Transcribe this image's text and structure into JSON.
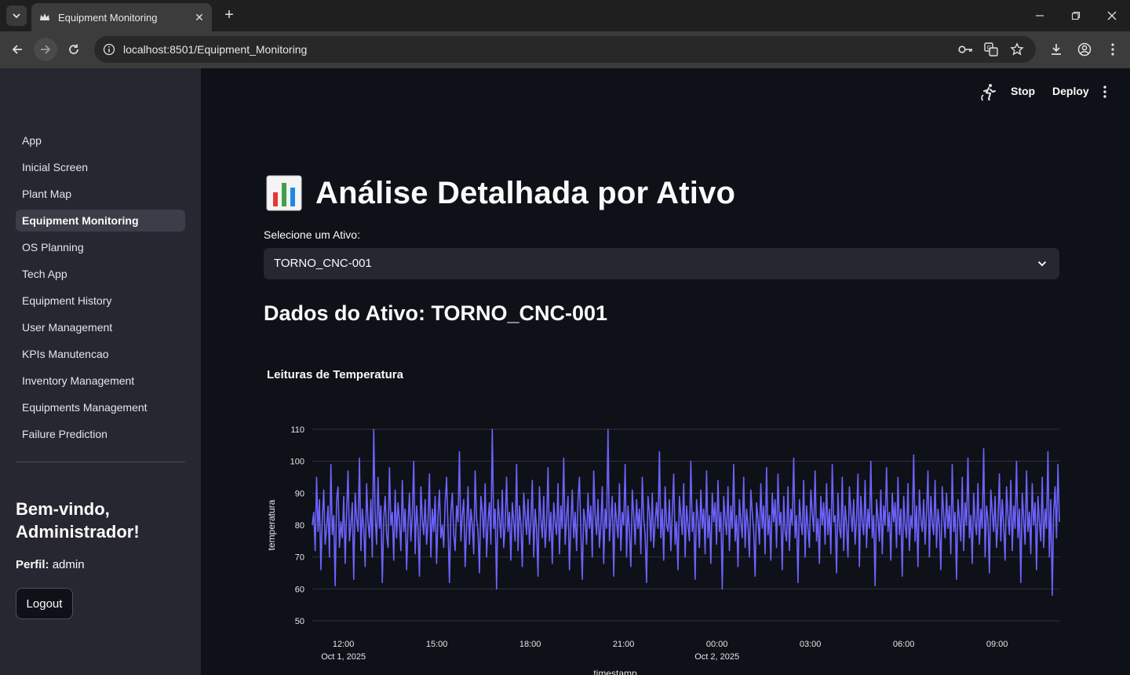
{
  "browser": {
    "tab_title": "Equipment Monitoring",
    "url": "localhost:8501/Equipment_Monitoring"
  },
  "sidebar": {
    "items": [
      {
        "label": "App",
        "active": false
      },
      {
        "label": "Inicial Screen",
        "active": false
      },
      {
        "label": "Plant Map",
        "active": false
      },
      {
        "label": "Equipment Monitoring",
        "active": true
      },
      {
        "label": "OS Planning",
        "active": false
      },
      {
        "label": "Tech App",
        "active": false
      },
      {
        "label": "Equipment History",
        "active": false
      },
      {
        "label": "User Management",
        "active": false
      },
      {
        "label": "KPIs Manutencao",
        "active": false
      },
      {
        "label": "Inventory Management",
        "active": false
      },
      {
        "label": "Equipments Management",
        "active": false
      },
      {
        "label": "Failure Prediction",
        "active": false
      }
    ],
    "welcome": "Bem-vindo, Administrador!",
    "profile_label": "Perfil:",
    "profile_value": "admin",
    "logout_label": "Logout"
  },
  "header": {
    "stop_label": "Stop",
    "deploy_label": "Deploy"
  },
  "main": {
    "title": "Análise Detalhada por Ativo",
    "title_icon": "bar-chart-emoji",
    "select_label": "Selecione um Ativo:",
    "select_value": "TORNO_CNC-001",
    "section_heading": "Dados do Ativo: TORNO_CNC-001",
    "chart_title": "Leituras de Temperatura"
  },
  "colors": {
    "accent": "#6c63ff",
    "background": "#0e1117",
    "sidebar": "#262730"
  },
  "chart_data": {
    "type": "line",
    "title": "Leituras de Temperatura",
    "xlabel": "timestamp",
    "ylabel": "temperatura",
    "ylim": [
      50,
      110
    ],
    "y_ticks": [
      50,
      60,
      70,
      80,
      90,
      100,
      110
    ],
    "x_ticks": [
      {
        "t": 0,
        "label": "12:00",
        "sub": "Oct 1, 2025"
      },
      {
        "t": 3,
        "label": "15:00",
        "sub": ""
      },
      {
        "t": 6,
        "label": "18:00",
        "sub": ""
      },
      {
        "t": 9,
        "label": "21:00",
        "sub": ""
      },
      {
        "t": 12,
        "label": "00:00",
        "sub": "Oct 2, 2025"
      },
      {
        "t": 15,
        "label": "03:00",
        "sub": ""
      },
      {
        "t": 18,
        "label": "06:00",
        "sub": ""
      },
      {
        "t": 21,
        "label": "09:00",
        "sub": ""
      }
    ],
    "x_range_hours": [
      -1,
      23
    ],
    "grid": true,
    "series": [
      {
        "values": [
          80,
          84,
          72,
          95,
          78,
          88,
          66,
          82,
          91,
          74,
          79,
          86,
          70,
          99,
          77,
          83,
          61,
          88,
          92,
          73,
          81,
          76,
          89,
          68,
          84,
          97,
          75,
          80,
          87,
          63,
          90,
          82,
          78,
          101,
          72,
          85,
          79,
          67,
          93,
          81,
          76,
          88,
          70,
          110,
          83,
          74,
          95,
          79,
          86,
          62,
          82,
          89,
          77,
          73,
          98,
          80,
          84,
          69,
          91,
          76,
          87,
          81,
          72,
          94,
          78,
          85,
          66,
          80,
          90,
          75,
          83,
          100,
          71,
          86,
          79,
          64,
          92,
          82,
          77,
          88,
          74,
          81,
          96,
          70,
          85,
          78,
          89,
          68,
          83,
          91,
          76,
          80,
          73,
          87,
          95,
          79,
          62,
          84,
          90,
          77,
          72,
          86,
          81,
          103,
          75,
          83,
          88,
          67,
          79,
          92,
          74,
          85,
          80,
          71,
          97,
          82,
          78,
          65,
          89,
          84,
          76,
          93,
          70,
          81,
          87,
          74,
          110,
          79,
          85,
          60,
          88,
          82,
          76,
          91,
          73,
          80,
          95,
          78,
          84,
          69,
          87,
          81,
          75,
          99,
          72,
          86,
          80,
          67,
          90,
          83,
          77,
          88,
          74,
          81,
          94,
          70,
          85,
          79,
          64,
          92,
          82,
          76,
          89,
          73,
          80,
          98,
          75,
          84,
          68,
          87,
          81,
          77,
          93,
          71,
          86,
          79,
          101,
          74,
          82,
          89,
          66,
          80,
          91,
          76,
          84,
          72,
          88,
          95,
          78,
          63,
          85,
          81,
          74,
          90,
          79,
          86,
          70,
          97,
          83,
          77,
          88,
          73,
          80,
          92,
          68,
          85,
          79,
          110,
          75,
          82,
          89,
          64,
          87,
          81,
          76,
          93,
          72,
          84,
          80,
          99,
          70,
          86,
          78,
          67,
          91,
          83,
          74,
          88,
          79,
          85,
          71,
          95,
          82,
          77,
          62,
          89,
          84,
          75,
          90,
          73,
          81,
          87,
          79,
          103,
          76,
          85,
          69,
          92,
          80,
          78,
          88,
          72,
          84,
          96,
          74,
          81,
          66,
          89,
          83,
          77,
          93,
          70,
          86,
          80,
          75,
          100,
          78,
          84,
          63,
          88,
          82,
          73,
          91,
          79,
          85,
          71,
          97,
          76,
          83,
          68,
          90,
          81,
          87,
          74,
          94,
          78,
          84,
          60,
          89,
          82,
          77,
          92,
          72,
          86,
          79,
          99,
          75,
          83,
          67,
          88,
          81,
          76,
          95,
          73,
          85,
          80,
          70,
          91,
          84,
          78,
          64,
          87,
          82,
          74,
          93,
          79,
          86,
          71,
          98,
          77,
          83,
          69,
          90,
          81,
          88,
          73,
          96,
          80,
          84,
          66,
          89,
          78,
          75,
          92,
          72,
          85,
          80,
          101,
          76,
          83,
          62,
          88,
          81,
          77,
          94,
          70,
          86,
          79,
          73,
          91,
          84,
          78,
          97,
          75,
          82,
          68,
          89,
          80,
          87,
          74,
          93,
          77,
          85,
          71,
          99,
          81,
          83,
          65,
          90,
          79,
          76,
          95,
          72,
          86,
          80,
          70,
          92,
          84,
          78,
          88,
          74,
          82,
          96,
          67,
          89,
          81,
          77,
          94,
          73,
          85,
          79,
          100,
          76,
          83,
          61,
          88,
          82,
          75,
          91,
          71,
          86,
          80,
          98,
          78,
          84,
          69,
          90,
          81,
          87,
          73,
          95,
          77,
          85,
          64,
          89,
          80,
          76,
          93,
          72,
          83,
          79,
          102,
          75,
          86,
          67,
          91,
          82,
          78,
          88,
          74,
          84,
          97,
          70,
          89,
          81,
          77,
          94,
          73,
          85,
          80,
          66,
          92,
          83,
          76,
          90,
          79,
          86,
          71,
          99,
          78,
          84,
          63,
          88,
          82,
          75,
          95,
          72,
          87,
          80,
          101,
          76,
          83,
          68,
          90,
          81,
          77,
          93,
          74,
          85,
          79,
          104,
          70,
          86,
          82,
          65,
          91,
          84,
          78,
          89,
          73,
          81,
          96,
          75,
          88,
          80,
          69,
          92,
          83,
          77,
          94,
          72,
          86,
          79,
          100,
          76,
          85,
          62,
          90,
          82,
          74,
          97,
          78,
          84,
          71,
          93,
          80,
          87,
          66,
          89,
          81,
          75,
          95,
          73,
          85,
          79,
          103,
          70,
          88,
          58,
          84,
          92,
          76,
          99,
          81
        ]
      }
    ]
  }
}
